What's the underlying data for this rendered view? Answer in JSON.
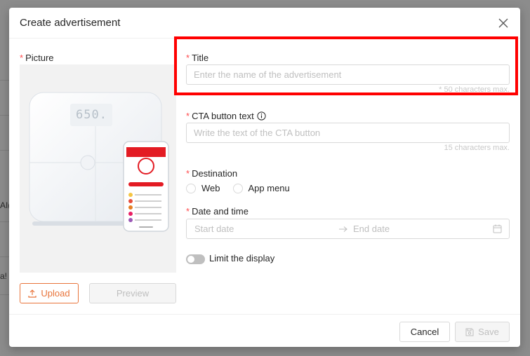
{
  "background": {
    "fragment_1": "AI(",
    "fragment_2": "a!"
  },
  "modal": {
    "title": "Create advertisement",
    "close_icon": "close-icon"
  },
  "picture": {
    "label": "Picture",
    "required_mark": "*",
    "scale_display": "650.",
    "upload_label": "Upload",
    "preview_label": "Preview"
  },
  "form": {
    "title": {
      "label": "Title",
      "required_mark": "*",
      "placeholder": "Enter the name of the advertisement",
      "hint": "* 50 characters max."
    },
    "cta": {
      "label": "CTA button text",
      "required_mark": "*",
      "placeholder": "Write the text of the CTA button",
      "hint": "15 characters max."
    },
    "destination": {
      "label": "Destination",
      "required_mark": "*",
      "options": [
        "Web",
        "App menu"
      ]
    },
    "datetime": {
      "label": "Date and time",
      "required_mark": "*",
      "start_placeholder": "Start date",
      "end_placeholder": "End date"
    },
    "limit_display": {
      "label": "Limit the display",
      "enabled": false
    }
  },
  "footer": {
    "cancel_label": "Cancel",
    "save_label": "Save"
  },
  "colors": {
    "accent": "#e8743b",
    "required": "#ff4d4f",
    "highlight": "#ff0000"
  }
}
